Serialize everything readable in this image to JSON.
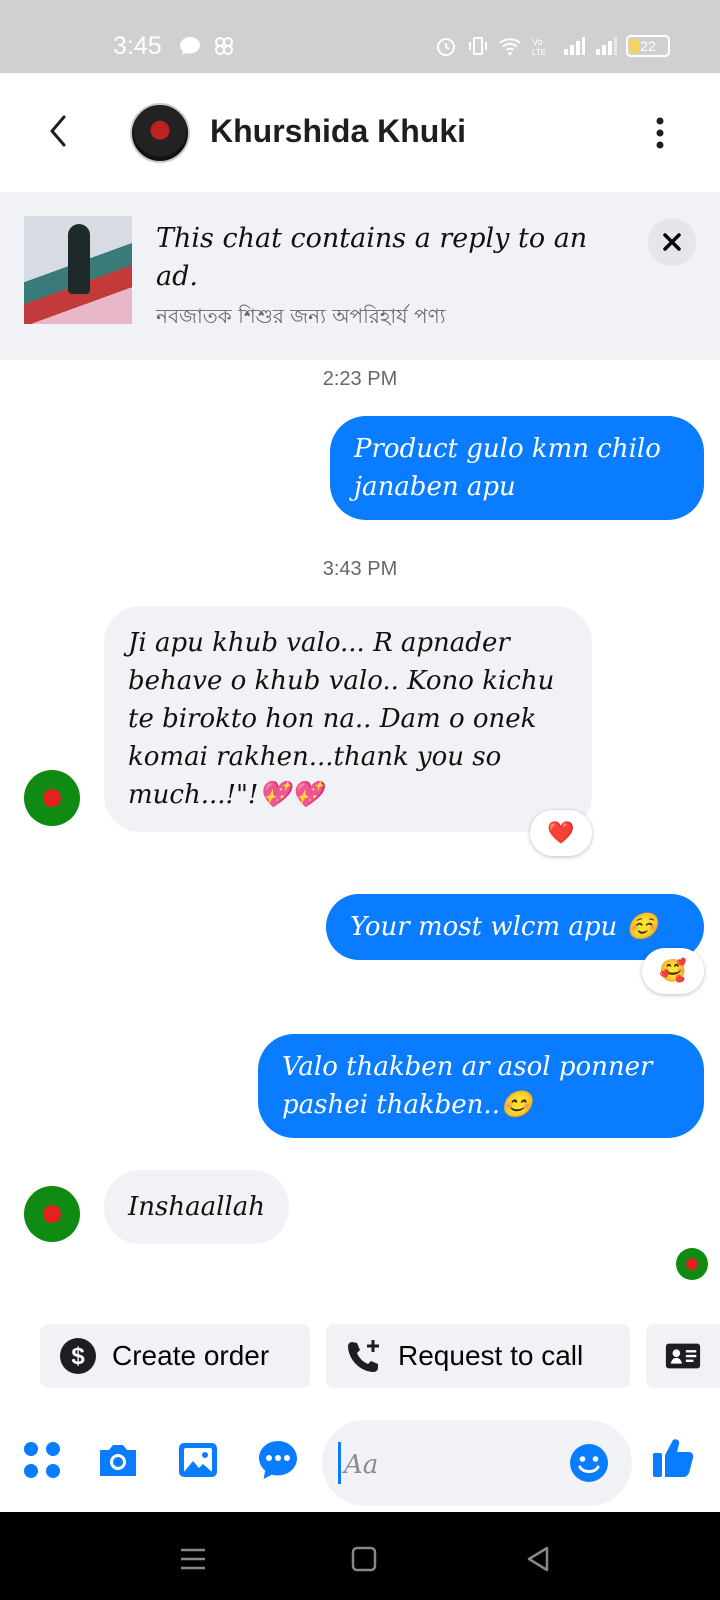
{
  "status_bar": {
    "time": "3:45",
    "battery": "22"
  },
  "header": {
    "contact_name": "Khurshida Khuki"
  },
  "ad_banner": {
    "title": "This chat contains a reply to an ad.",
    "subtitle": "নবজাতক শিশুর জন্য অপরিহার্য  পণ্য"
  },
  "messages": [
    {
      "type": "timestamp",
      "text": "2:23 PM"
    },
    {
      "type": "outgoing",
      "text": "Product gulo kmn chilo janaben apu"
    },
    {
      "type": "timestamp",
      "text": "3:43 PM"
    },
    {
      "type": "incoming",
      "text": "Ji apu khub valo... R apnader behave o khub valo..  Kono kichu te birokto hon na.. Dam o onek komai rakhen...thank you so much...!\"!💖💖",
      "reaction": "❤️"
    },
    {
      "type": "outgoing",
      "text": "Your most wlcm apu ☺️",
      "reaction": "🥰"
    },
    {
      "type": "outgoing",
      "text": "Valo thakben ar asol ponner pashei thakben..😊"
    },
    {
      "type": "incoming",
      "text": "Inshaallah"
    }
  ],
  "quick_actions": {
    "create_order": "Create order",
    "request_call": "Request to call"
  },
  "composer": {
    "placeholder": "Aa"
  },
  "colors": {
    "accent": "#0a7cff",
    "incoming_bubble": "#f0f2f5",
    "status_bar": "#cfd0d2"
  }
}
